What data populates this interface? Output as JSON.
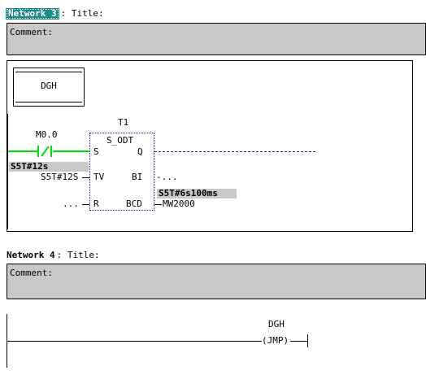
{
  "network3": {
    "badge": "Network 3",
    "title_label": ": Title:",
    "comment_label": "Comment:",
    "jump_label": "DGH",
    "contact": {
      "address": "M0.0"
    },
    "timer": {
      "name": "T1",
      "type": "S_ODT",
      "pins": {
        "s": "S",
        "q": "Q",
        "tv": "TV",
        "bi": "BI",
        "r": "R",
        "bcd": "BCD"
      },
      "tv_param": "S5T#12S",
      "tv_status": "S5T#12s",
      "bi_param": "-...",
      "r_param": "...",
      "bcd_status": "S5T#6s100ms",
      "bcd_param": "MW2000"
    }
  },
  "network4": {
    "label": "Network 4",
    "title_label": ": Title:",
    "comment_label": "Comment:",
    "jmp": {
      "label": "DGH",
      "instruction": "(JMP)"
    }
  },
  "colors": {
    "power_flow": "#00e000",
    "badge_bg": "#1e8a8a",
    "comment_bg": "#c8c8c8",
    "dotted_line": "#1a1aa0"
  }
}
